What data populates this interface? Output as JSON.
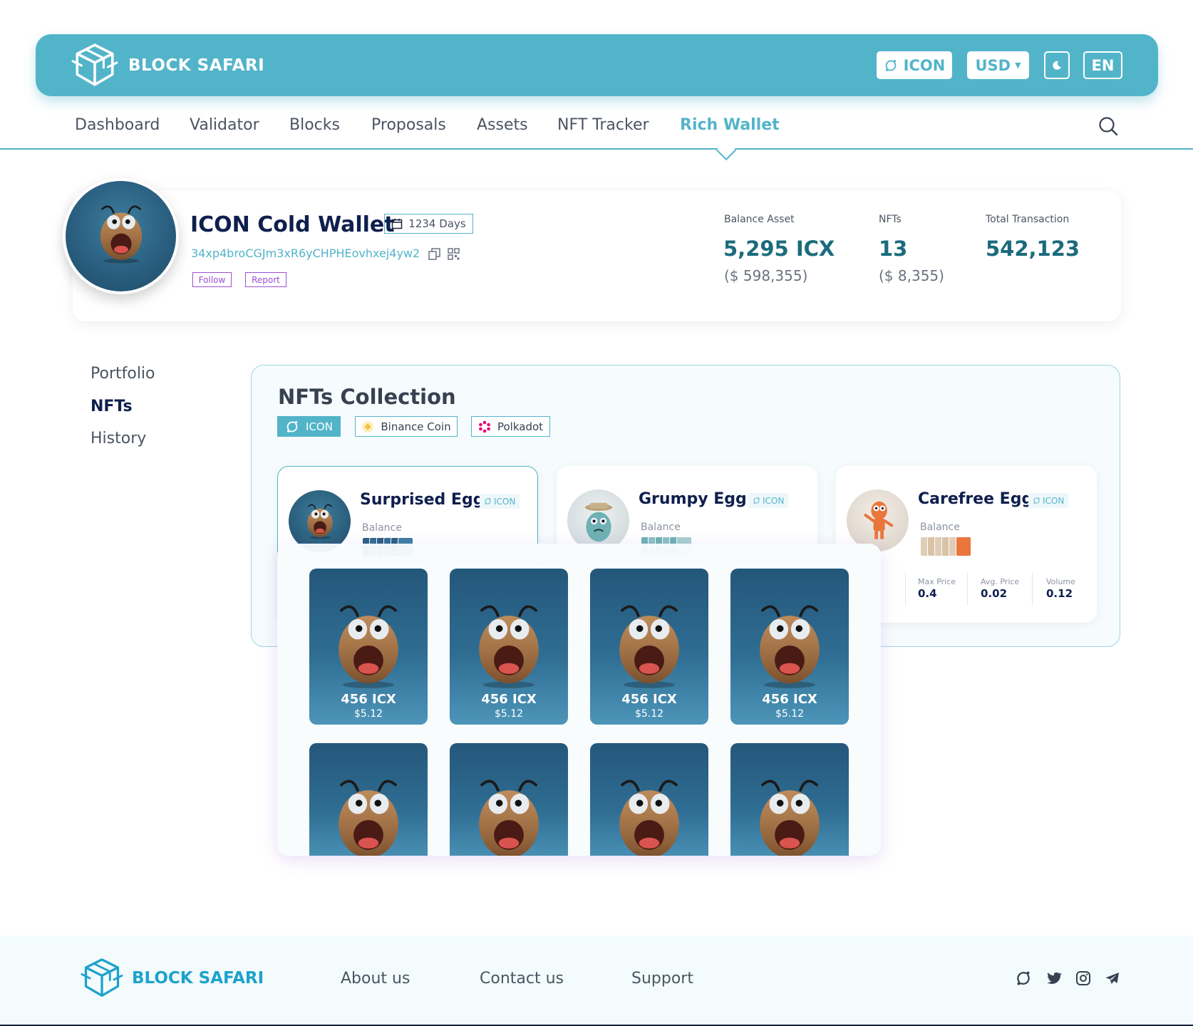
{
  "header": {
    "brand": "BLOCK SAFARI",
    "network_button": "ICON",
    "currency_button": "USD",
    "language_button": "EN",
    "accent_color": "#52b4c9"
  },
  "nav": {
    "items": [
      "Dashboard",
      "Validator",
      "Blocks",
      "Proposals",
      "Assets",
      "NFT Tracker",
      "Rich Wallet"
    ],
    "active": "Rich Wallet"
  },
  "profile": {
    "title": "ICON Cold Wallet",
    "days": "1234 Days",
    "address": "34xp4broCGJm3xR6yCHPHEovhxej4yw2",
    "follow_label": "Follow",
    "report_label": "Report",
    "stats": [
      {
        "label": "Balance Asset",
        "value": "5,295 ICX",
        "sub": "($ 598,355)"
      },
      {
        "label": "NFTs",
        "value": "13",
        "sub": "($ 8,355)"
      },
      {
        "label": "Total Transaction",
        "value": "542,123",
        "sub": ""
      }
    ]
  },
  "side_menu": {
    "items": [
      "Portfolio",
      "NFTs",
      "History"
    ],
    "active": "NFTs"
  },
  "collection": {
    "title": "NFTs Collection",
    "chips": [
      "ICON",
      "Binance Coin",
      "Polkadot"
    ],
    "active_chip": "ICON",
    "cards": [
      {
        "name": "Surprised Egg",
        "network": "ICON",
        "balance_label": "Balance"
      },
      {
        "name": "Grumpy Egg",
        "network": "ICON",
        "balance_label": "Balance"
      },
      {
        "name": "Carefree Egg",
        "network": "ICON",
        "balance_label": "Balance",
        "stats": [
          {
            "label": "Max Price",
            "value": "0.4"
          },
          {
            "label": "Avg. Price",
            "value": "0.02"
          },
          {
            "label": "Volume",
            "value": "0.12"
          }
        ]
      }
    ]
  },
  "popup": {
    "tiles": [
      {
        "price": "456 ICX",
        "usd": "$5.12"
      },
      {
        "price": "456 ICX",
        "usd": "$5.12"
      },
      {
        "price": "456 ICX",
        "usd": "$5.12"
      },
      {
        "price": "456 ICX",
        "usd": "$5.12"
      }
    ]
  },
  "footer": {
    "brand": "BLOCK SAFARI",
    "links": [
      "About us",
      "Contact us",
      "Support"
    ],
    "social_icons": [
      "icon-network-icon",
      "twitter-icon",
      "instagram-icon",
      "telegram-icon"
    ]
  }
}
